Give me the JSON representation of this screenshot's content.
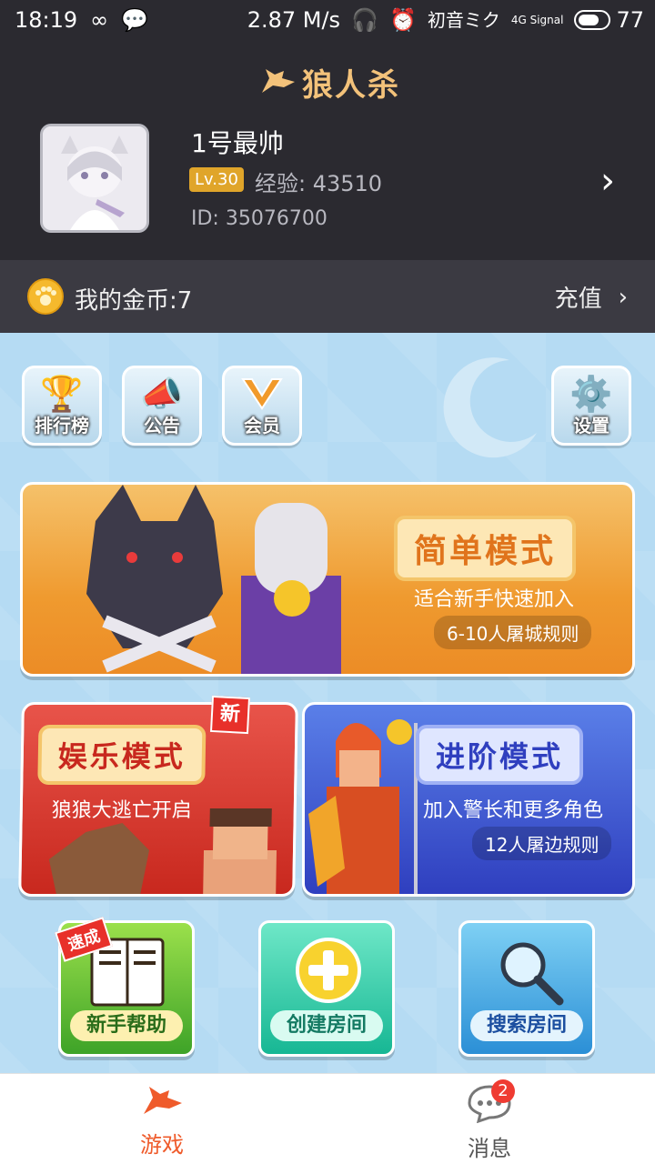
{
  "status": {
    "time": "18:19",
    "speed": "2.87 M/s",
    "carrier": "初音ミク",
    "network": "4G Signal",
    "battery": "77"
  },
  "header": {
    "logo": "狼人杀",
    "nickname": "1号最帅",
    "level": "Lv.30",
    "exp": "经验: 43510",
    "id": "ID: 35076700"
  },
  "coins": {
    "label": "我的金币:7",
    "recharge": "充值"
  },
  "top_icons": [
    {
      "label": "排行榜"
    },
    {
      "label": "公告"
    },
    {
      "label": "会员"
    },
    {
      "label": "设置"
    }
  ],
  "modes": {
    "easy": {
      "title": "简单模式",
      "subtitle": "适合新手快速加入",
      "rule": "6-10人屠城规则"
    },
    "fun": {
      "title": "娱乐模式",
      "subtitle": "狼狼大逃亡开启",
      "tag": "新"
    },
    "advanced": {
      "title": "进阶模式",
      "subtitle": "加入警长和更多角色",
      "rule": "12人屠边规则"
    }
  },
  "quick": {
    "help": "新手帮助",
    "help_tag": "速成",
    "create": "创建房间",
    "search": "搜索房间"
  },
  "tabs": {
    "game": "游戏",
    "messages": "消息",
    "messages_badge": "2"
  }
}
